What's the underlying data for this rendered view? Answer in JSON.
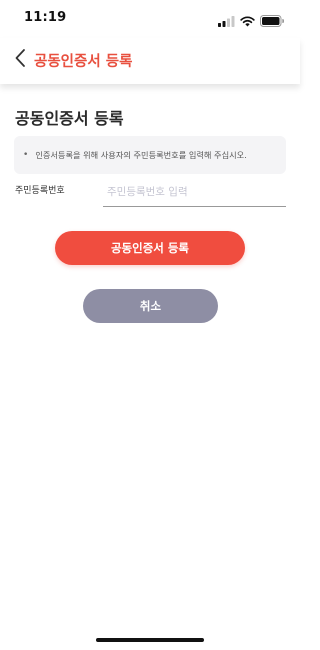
{
  "status_bar": {
    "time": "11:19"
  },
  "header": {
    "title": "공동인증서 등록",
    "back_icon": "chevron-left-icon",
    "accent_color": "#e8503f"
  },
  "main": {
    "page_title": "공동인증서 등록",
    "notice": {
      "bullet": "•",
      "text": "인증서등록을 위해 사용자의 주민등록번호를 입력해 주십시오."
    },
    "rrn_field": {
      "label": "주민등록번호",
      "value": "",
      "placeholder": "주민등록번호 입력"
    }
  },
  "buttons": {
    "register_label": "공동인증서 등록",
    "register_color": "#f04d3f",
    "cancel_label": "취소",
    "cancel_color": "#8e8ea4"
  }
}
